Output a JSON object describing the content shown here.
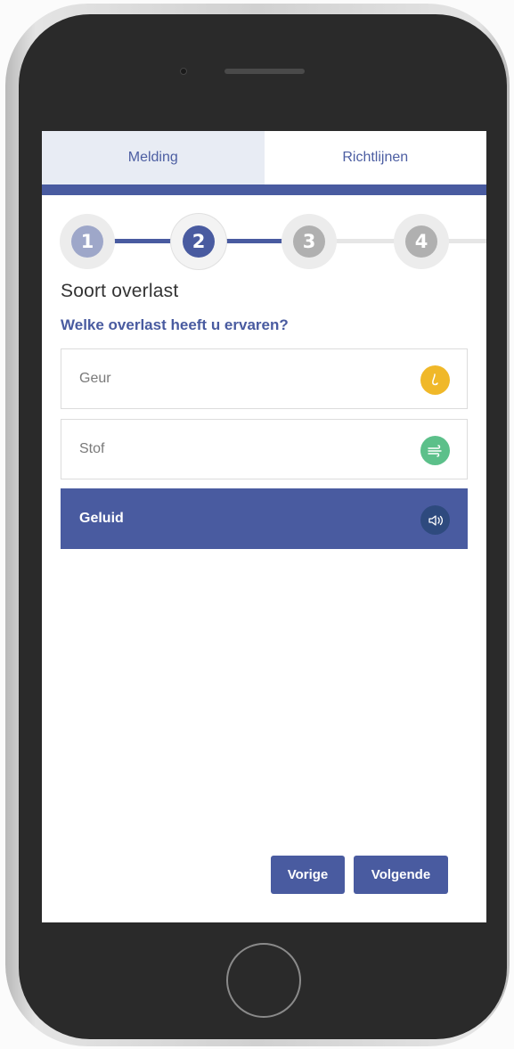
{
  "tabs": [
    {
      "label": "Melding",
      "active": true
    },
    {
      "label": "Richtlijnen",
      "active": false
    }
  ],
  "stepper": {
    "steps": [
      {
        "number": "1",
        "state": "done",
        "color": "#9ea7c9"
      },
      {
        "number": "2",
        "state": "active",
        "color": "#495ba0"
      },
      {
        "number": "3",
        "state": "upcoming",
        "color": "#b0b0b0"
      },
      {
        "number": "4",
        "state": "upcoming",
        "color": "#b0b0b0"
      }
    ],
    "current_step": 2
  },
  "page": {
    "title": "Soort overlast",
    "question": "Welke overlast heeft u ervaren?"
  },
  "options": [
    {
      "label": "Geur",
      "icon": "nose-icon",
      "icon_color": "#f0b829",
      "selected": false
    },
    {
      "label": "Stof",
      "icon": "wind-icon",
      "icon_color": "#5cc08a",
      "selected": false
    },
    {
      "label": "Geluid",
      "icon": "speaker-icon",
      "icon_color": "#2e4a7e",
      "selected": true
    }
  ],
  "buttons": {
    "previous": "Vorige",
    "next": "Volgende"
  },
  "colors": {
    "primary": "#495ba0",
    "tab_active_bg": "#e8ecf4"
  }
}
